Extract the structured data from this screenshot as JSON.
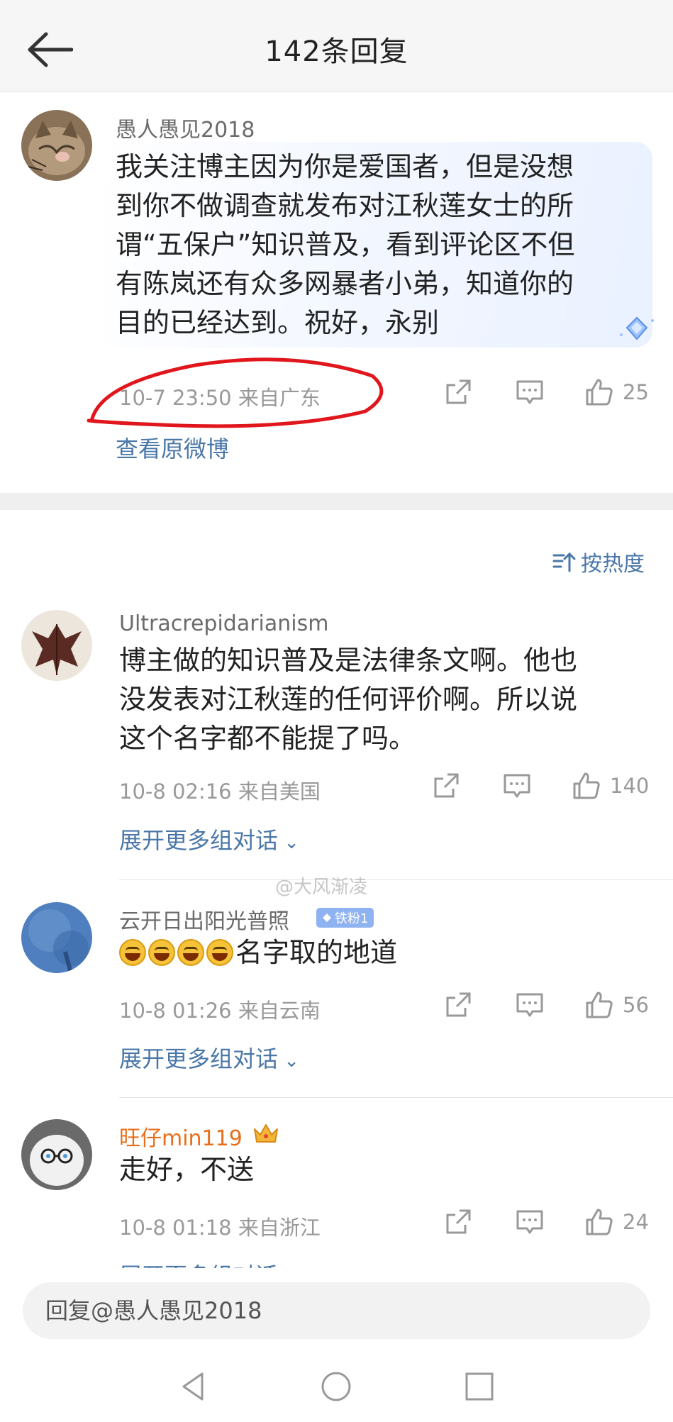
{
  "header": {
    "title": "142条回复"
  },
  "main_comment": {
    "username": "愚人愚见2018",
    "lines": [
      "我关注博主因为你是爱国者，但是没想",
      "到你不做调查就发布对江秋莲女士的所",
      "谓“五保户”知识普及，看到评论区不但",
      "有陈岚还有众多网暴者小弟，知道你的",
      "目的已经达到。祝好，永别"
    ],
    "time_location": "10-7 23:50  来自广东",
    "likes": "25",
    "view_original": "查看原微博"
  },
  "sort": {
    "label": "按热度"
  },
  "replies": [
    {
      "username": "Ultracrepidarianism",
      "lines": [
        "博主做的知识普及是法律条文啊。他也",
        "没发表对江秋莲的任何评价啊。所以说",
        "这个名字都不能提了吗。"
      ],
      "time_location": "10-8 02:16  来自美国",
      "likes": "140",
      "expand": "展开更多组对话"
    },
    {
      "username": "云开日出阳光普照",
      "badge": "铁粉1",
      "text": "名字取的地道",
      "time_location": "10-8 01:26  来自云南",
      "likes": "56",
      "expand": "展开更多组对话"
    },
    {
      "username": "旺仔min119",
      "text": "走好，不送",
      "time_location": "10-8 01:18  来自浙江",
      "likes": "24",
      "expand": "展开更多组对话"
    }
  ],
  "watermark": "@大风渐凌",
  "reply_bar": {
    "placeholder": "回复@愚人愚见2018"
  },
  "colors": {
    "link": "#4a77a8",
    "highlight_user": "#e86f1a",
    "badge": "#8fb3f0",
    "annotation": "#e0161c"
  }
}
